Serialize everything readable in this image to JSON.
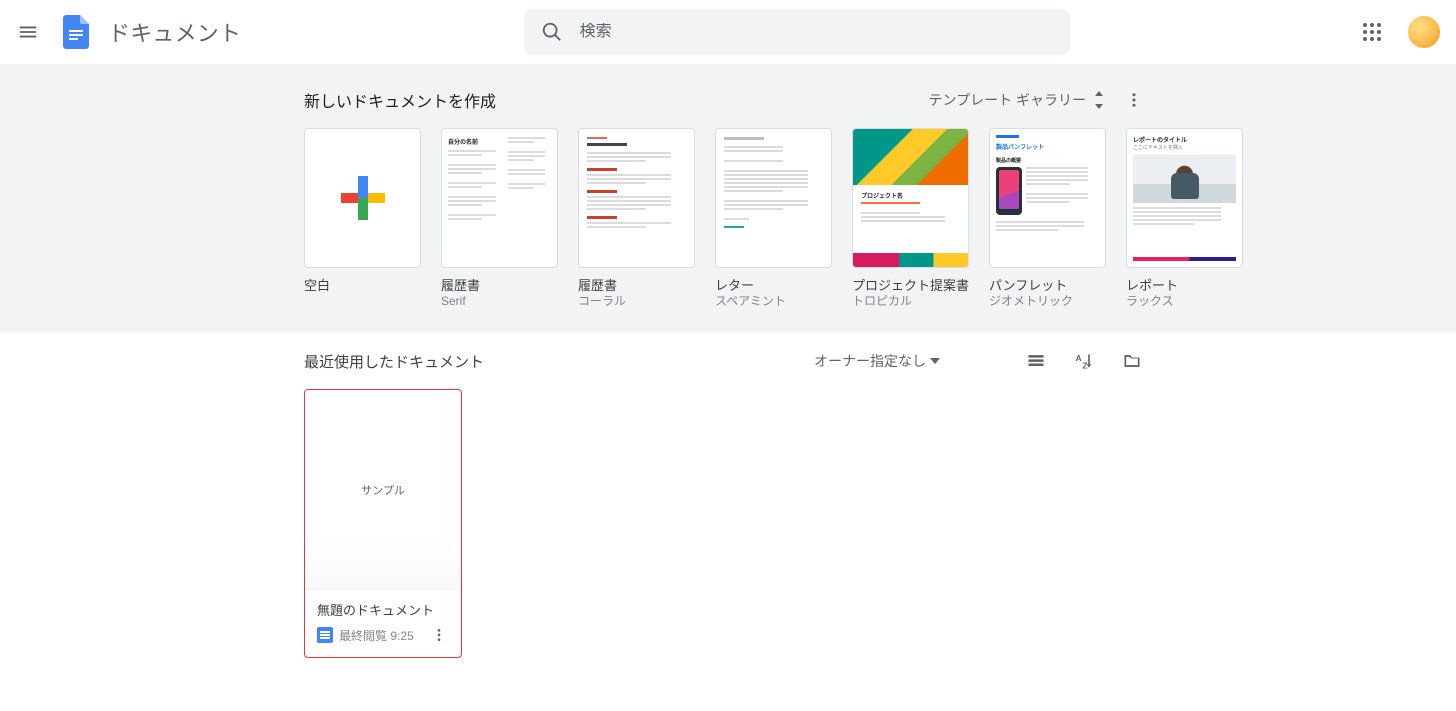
{
  "header": {
    "app_name": "ドキュメント",
    "search_placeholder": "検索"
  },
  "gallery": {
    "title": "新しいドキュメントを作成",
    "toggle_label": "テンプレート ギャラリー",
    "thumb_text": {
      "resume_serif_heading": "自分の名前",
      "tropical_title": "プロジェクト名",
      "brochure_title": "製品パンフレット",
      "brochure_section": "製品の概要",
      "report_title": "レポートのタイトル",
      "report_sub": "ここにテキストを挿入"
    },
    "templates": [
      {
        "label": "空白",
        "sublabel": ""
      },
      {
        "label": "履歴書",
        "sublabel": "Serif"
      },
      {
        "label": "履歴書",
        "sublabel": "コーラル"
      },
      {
        "label": "レター",
        "sublabel": "スペアミント"
      },
      {
        "label": "プロジェクト提案書",
        "sublabel": "トロピカル"
      },
      {
        "label": "パンフレット",
        "sublabel": "ジオメトリック"
      },
      {
        "label": "レポート",
        "sublabel": "ラックス"
      }
    ]
  },
  "recent": {
    "title": "最近使用したドキュメント",
    "owner_filter": "オーナー指定なし",
    "docs": [
      {
        "title": "無題のドキュメント",
        "preview_text": "サンプル",
        "timestamp": "最終閲覧 9:25"
      }
    ]
  }
}
